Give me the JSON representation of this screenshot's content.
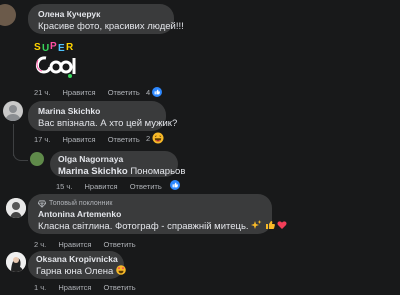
{
  "actions": {
    "like": "Нравится",
    "reply": "Ответить"
  },
  "comments": [
    {
      "author": "Олена Кучерук",
      "text": "Красиве фото, красивих людей!!!",
      "sticker_text": "SUPER COOL",
      "time": "21 ч.",
      "reactions": "4"
    },
    {
      "author": "Marina Skichko",
      "text": "Вас впізнала. А хто цей мужик?",
      "time": "17 ч.",
      "reactions": "2"
    },
    {
      "author": "Olga Nagornaya",
      "mention": "Marina Skichko",
      "text": "Пономарьов",
      "time": "15 ч.",
      "reactions": ""
    },
    {
      "badge": "Топовый поклонник",
      "author": "Antonina Artemenko",
      "text": "Класна світлина. Фотограф - справжній митець.",
      "time": "2 ч.",
      "reactions": ""
    },
    {
      "author": "Oksana Kropivnicka",
      "text": "Гарна юна Олена",
      "time": "1 ч.",
      "reactions": ""
    }
  ],
  "colors": {
    "background": "#18191a",
    "bubble": "#3a3b3c",
    "like": "#2d88ff",
    "heart": "#f33e58"
  }
}
